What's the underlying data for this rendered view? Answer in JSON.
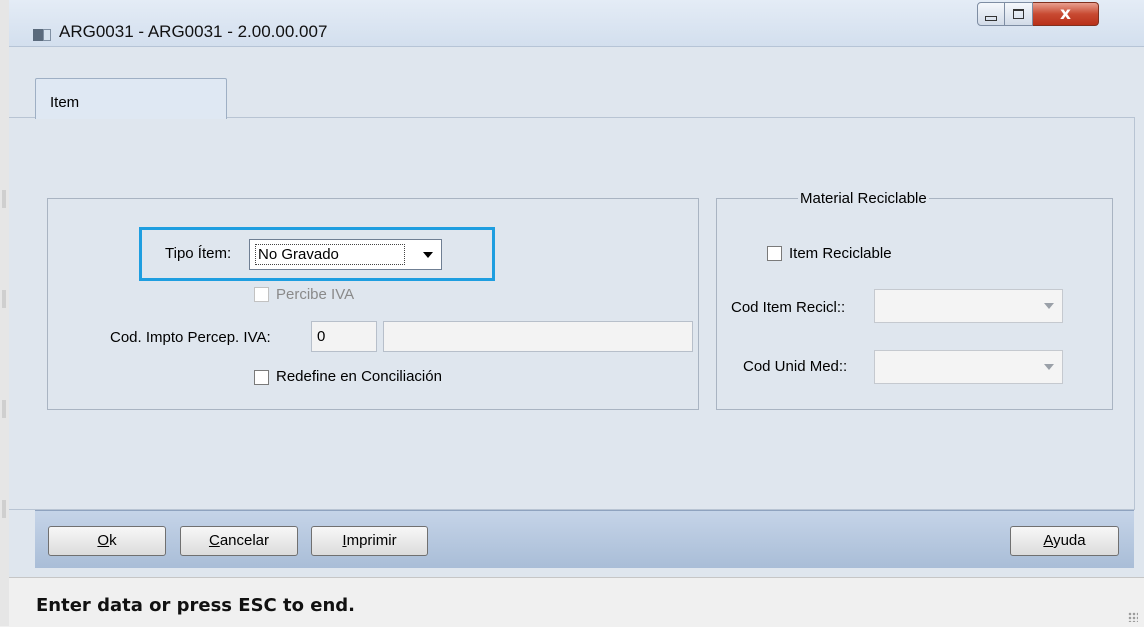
{
  "window": {
    "title": "ARG0031 - ARG0031 - 2.00.00.007",
    "controls": {
      "minimize": "minimize",
      "maximize": "maximize",
      "close": "x"
    }
  },
  "tabs": [
    {
      "label": "Item",
      "active": true
    }
  ],
  "form": {
    "tipo_item": {
      "label": "Tipo Ítem:",
      "value": "No Gravado"
    },
    "percibe_iva": {
      "label": "Percibe IVA",
      "checked": false,
      "enabled": false
    },
    "cod_impto": {
      "label": "Cod. Impto Percep. IVA:",
      "code": "0",
      "description": ""
    },
    "redefine": {
      "label": "Redefine en Conciliación",
      "checked": false
    }
  },
  "material_reciclable": {
    "legend": "Material Reciclable",
    "item_reciclable": {
      "label": "Item Reciclable",
      "checked": false
    },
    "cod_item_recicl": {
      "label": "Cod Item Recicl::",
      "value": ""
    },
    "cod_unid_med": {
      "label": "Cod Unid Med::",
      "value": ""
    }
  },
  "buttons": {
    "ok": {
      "mnemonic": "O",
      "rest": "k"
    },
    "cancelar": {
      "mnemonic": "C",
      "rest": "ancelar"
    },
    "imprimir": {
      "mnemonic": "I",
      "rest": "mprimir"
    },
    "ayuda": {
      "mnemonic": "A",
      "rest": "yuda"
    }
  },
  "status": "Enter data or press ESC to end.",
  "colors": {
    "highlight": "#1e9ee0",
    "close_button": "#c84a32"
  }
}
